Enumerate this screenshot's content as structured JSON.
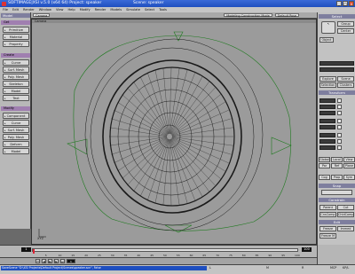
{
  "window": {
    "title": "SOFTIMAGE|XSI v.5.0 (x64 64) Project: speaker",
    "scene": "Scene: speaker",
    "buttons": [
      "_",
      "□",
      "x"
    ]
  },
  "menubar": [
    "File",
    "Edit",
    "Render",
    "Window",
    "View",
    "Help",
    "Modify",
    "Render",
    "Models",
    "Simulate",
    "Select",
    "Tools"
  ],
  "toolbar": {
    "camera": "Camera",
    "mode": "Modeling Construction Mode",
    "layout": "Default Pose"
  },
  "left_palette": {
    "mode": "Model",
    "sections": [
      {
        "name": "Get",
        "items": [
          "Primitive",
          "Material",
          "Property"
        ]
      },
      {
        "name": "Create",
        "items": [
          "Curve",
          "Surf. Mesh",
          "Poly. Mesh",
          "Skeleton",
          "Model",
          "Text"
        ]
      },
      {
        "name": "Modify",
        "items": [
          "Component",
          "Curve",
          "Surf. Mesh",
          "Poly. Mesh",
          "Deform",
          "Model"
        ]
      }
    ]
  },
  "viewport": {
    "label": "Camera",
    "axis": "XYZ"
  },
  "right_panel": {
    "select": "Select",
    "buttons": [
      "Group",
      "Center",
      "Object"
    ],
    "explore": "Explore",
    "scene": "Scene",
    "selection": "Selection",
    "clusters": "Clusters",
    "transform": "Transform",
    "coords": [
      "Global",
      "Local",
      "View"
    ],
    "ref": [
      "Par",
      "Ref",
      "Plane"
    ],
    "cog": [
      "Cog",
      "Prop",
      "Sym"
    ],
    "snap": "Snap",
    "constrain": "Constrain",
    "parent": "Parent",
    "cut": "Cut",
    "compensation": [
      "CnsComp",
      "ChldComp"
    ],
    "edit": "Edit",
    "freeze": "Freeze",
    "immed": "Immed",
    "freeze_m": "Freeze M"
  },
  "timeline": {
    "start": "1",
    "end": "100",
    "current": "1",
    "ticks": [
      "5",
      "10",
      "15",
      "20",
      "25",
      "30",
      "35",
      "40",
      "45",
      "50",
      "55",
      "60",
      "65",
      "70",
      "75",
      "80",
      "85",
      "90",
      "95",
      "100"
    ],
    "progress": 0.0
  },
  "status": {
    "message": "SaveScene \"D:\\XSI Projects\\Default Project\\Scenes\\speaker.scn\", False",
    "mcp": "MCP",
    "kp": "KP/L"
  },
  "colors": {
    "viewport_bg": "#9b9b9b",
    "wire": "#1a1a1a",
    "curve": "#1e7a1e",
    "title": "#1f4fbf",
    "header": "#7e7e9e"
  }
}
